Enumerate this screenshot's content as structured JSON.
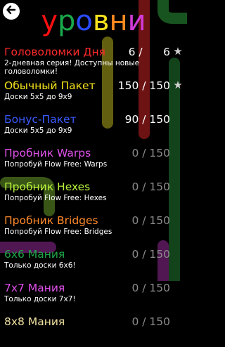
{
  "header": {
    "title_letters": [
      {
        "char": "у",
        "color": "#ff1010"
      },
      {
        "char": "р",
        "color": "#19a84a"
      },
      {
        "char": "о",
        "color": "#2a4cff"
      },
      {
        "char": "в",
        "color": "#f5e21c"
      },
      {
        "char": "н",
        "color": "#ff8a1f"
      },
      {
        "char": "и",
        "color": "#d23bd8"
      }
    ],
    "back_icon": "arrow-left-icon"
  },
  "levels": [
    {
      "title": "Головоломки Дня",
      "color": "#ff2a2a",
      "desc": "2-дневная серия! Доступны новые головоломки!",
      "count": "6 /      6",
      "star": true,
      "dim": false
    },
    {
      "title": "Обычный Пакет",
      "color": "#f5e21c",
      "desc": "Доски 5x5 до 9x9",
      "count": "150 / 150",
      "star": true,
      "dim": false
    },
    {
      "title": "Бонус-Пакет",
      "color": "#3a5bff",
      "desc": "Доски 5x5 до 9x9",
      "count": "90 / 150",
      "star": false,
      "dim": false
    },
    {
      "title": "Пробник Warps",
      "color": "#e050ea",
      "desc": "Попробуй Flow Free: Warps",
      "count": "0 / 150",
      "star": false,
      "dim": true
    },
    {
      "title": "Пробник Hexes",
      "color": "#b8f23a",
      "desc": "Попробуй Flow Free: Hexes",
      "count": "0 / 150",
      "star": false,
      "dim": true
    },
    {
      "title": "Пробник Bridges",
      "color": "#ff8a2a",
      "desc": "Попробуй Flow Free: Bridges",
      "count": "0 / 150",
      "star": false,
      "dim": true
    },
    {
      "title": "6x6 Мания",
      "color": "#1ea84a",
      "desc": "Только доски 6x6!",
      "count": "0 / 150",
      "star": false,
      "dim": true
    },
    {
      "title": "7x7 Мания",
      "color": "#e050ea",
      "desc": "Только доски 7x7!",
      "count": "0 / 150",
      "star": false,
      "dim": true
    },
    {
      "title": "8x8 Мания",
      "color": "#f0e0a0",
      "desc": "",
      "count": "0 / 150",
      "star": false,
      "dim": true
    }
  ],
  "colors": {
    "background": "#000000",
    "pipe_green": "#1b5e24",
    "pipe_yellow": "#6e6a12",
    "pipe_red": "#7a1616",
    "pipe_purple": "#5a1a5c",
    "pipe_lime": "#41601a"
  }
}
